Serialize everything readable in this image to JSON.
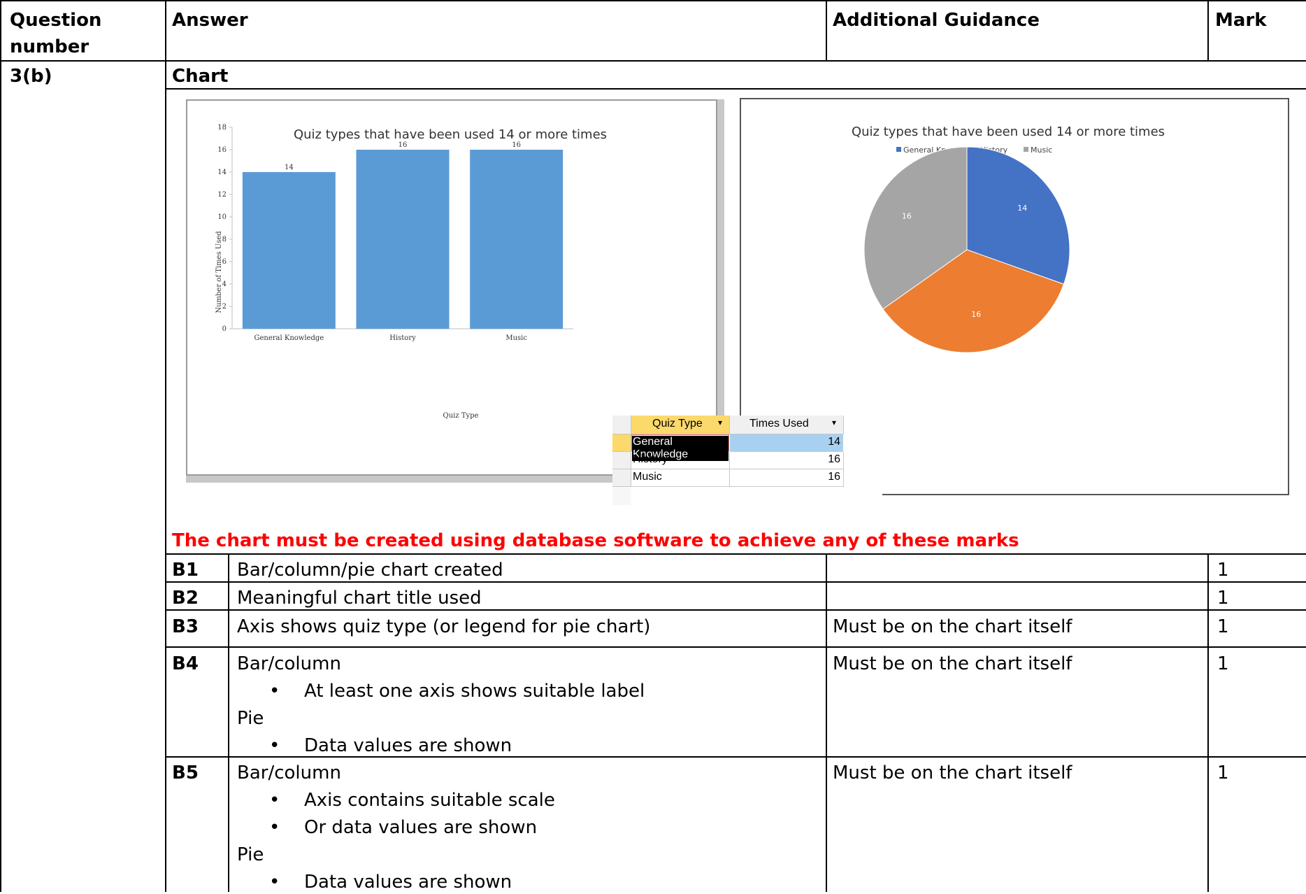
{
  "table_header": {
    "question_number": "Question number",
    "answer": "Answer",
    "additional_guidance": "Additional Guidance",
    "mark": "Mark"
  },
  "question": "3(b)",
  "section": "Chart",
  "chart_data": [
    {
      "type": "bar",
      "title": "Quiz types that have been used 14 or more times",
      "xlabel": "Quiz Type",
      "ylabel": "Number of Times Used",
      "categories": [
        "General Knowledge",
        "History",
        "Music"
      ],
      "values": [
        14,
        16,
        16
      ],
      "ylim": [
        0,
        18
      ],
      "yticks": [
        0,
        2,
        4,
        6,
        8,
        10,
        12,
        14,
        16,
        18
      ],
      "data_labels": true,
      "color": "#5b9bd5"
    },
    {
      "type": "pie",
      "title": "Quiz types that have been used 14 or more times",
      "categories": [
        "General Knowledge",
        "History",
        "Music"
      ],
      "values": [
        14,
        16,
        16
      ],
      "colors": [
        "#4472c4",
        "#ed7d31",
        "#a5a5a5"
      ],
      "legend": "top"
    }
  ],
  "query_table": {
    "headers": [
      "Quiz Type",
      "Times Used"
    ],
    "rows": [
      [
        "General Knowledge",
        "14"
      ],
      [
        "History",
        "16"
      ],
      [
        "Music",
        "16"
      ]
    ]
  },
  "requirement_note": "The chart must be created using database software to achieve any of these marks",
  "marks": [
    {
      "code": "B1",
      "answer": "Bar/column/pie chart created",
      "guidance": "",
      "mark": "1"
    },
    {
      "code": "B2",
      "answer": "Meaningful chart title used",
      "guidance": "",
      "mark": "1"
    },
    {
      "code": "B3",
      "answer": "Axis shows quiz type (or legend for pie chart)",
      "guidance": "Must be on the chart itself",
      "mark": "1"
    },
    {
      "code": "B4",
      "answer": "Bar/column",
      "bullets": [
        "At least one axis shows suitable label"
      ],
      "sub": "Pie",
      "sub_bullets": [
        "Data values are shown"
      ],
      "guidance": "Must be on the chart itself",
      "mark": "1"
    },
    {
      "code": "B5",
      "answer": "Bar/column",
      "bullets": [
        "Axis contains suitable scale",
        "Or data values are shown"
      ],
      "sub": "Pie",
      "sub_bullets": [
        "Data values are shown"
      ],
      "guidance": "Must be on the chart itself",
      "mark": "1"
    }
  ]
}
